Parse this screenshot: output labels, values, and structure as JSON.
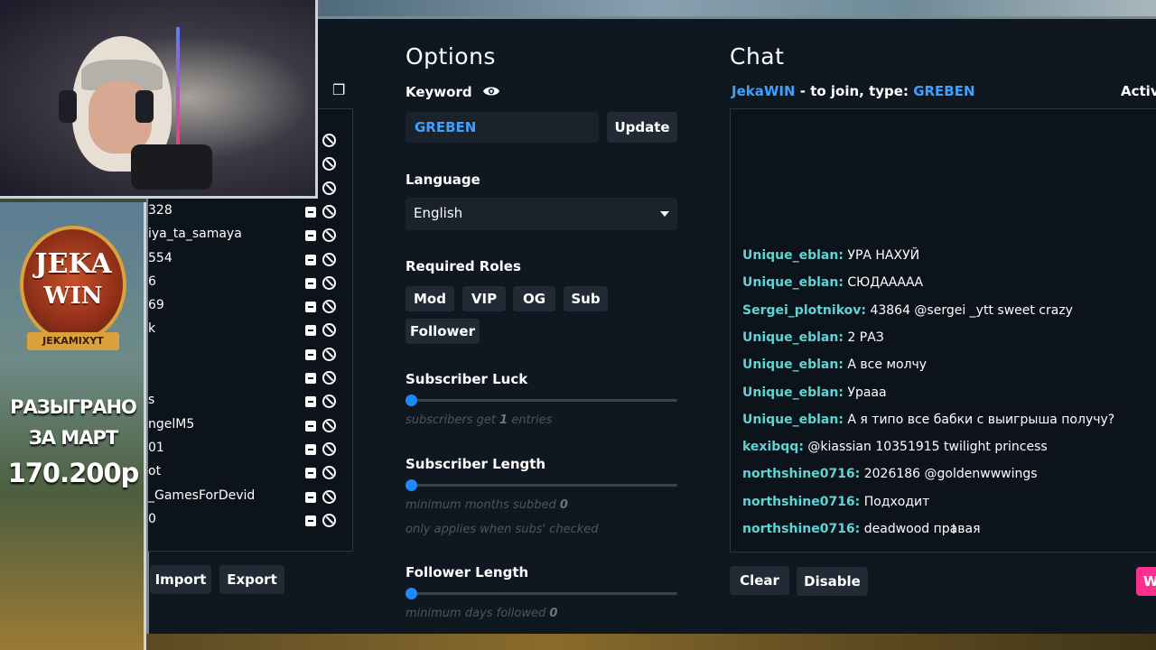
{
  "options": {
    "title": "Options",
    "keyword_label": "Keyword",
    "keyword_value": "GREBEN",
    "update_label": "Update",
    "language_label": "Language",
    "language_value": "English",
    "roles_label": "Required Roles",
    "roles": [
      "Mod",
      "VIP",
      "OG",
      "Sub",
      "Follower"
    ],
    "subscriber_luck_label": "Subscriber Luck",
    "subscriber_luck_hint_pre": "subscribers get",
    "subscriber_luck_value": "1",
    "subscriber_luck_hint_post": "entries",
    "subscriber_length_label": "Subscriber Length",
    "subscriber_length_hint_pre": "minimum months subbed",
    "subscriber_length_value": "0",
    "subscriber_length_note": "only applies when subs' checked",
    "follower_length_label": "Follower Length",
    "follower_length_hint_pre": "minimum days followed",
    "follower_length_value": "0"
  },
  "entries": {
    "users": [
      "328",
      "iya_ta_samaya",
      "554",
      "6",
      "69",
      "k",
      "",
      "",
      "s",
      "ngelM5",
      "01",
      "ot",
      "_GamesForDevid",
      "0"
    ],
    "import_label": "Import",
    "export_label": "Export"
  },
  "chat": {
    "title": "Chat",
    "streamer": "JekaWIN",
    "join_text": " - to join, type: ",
    "join_keyword": "GREBEN",
    "active_label": "Active",
    "messages": [
      {
        "user": "Unique_eblan:",
        "text": "УРА НАХУЙ"
      },
      {
        "user": "Unique_eblan:",
        "text": "СЮДААААА"
      },
      {
        "user": "Sergei_plotnikov:",
        "text": "43864 @sergei _ytt sweet crazy"
      },
      {
        "user": "Unique_eblan:",
        "text": "2 РАЗ"
      },
      {
        "user": "Unique_eblan:",
        "text": "А все молчу"
      },
      {
        "user": "Unique_eblan:",
        "text": "Урааа"
      },
      {
        "user": "Unique_eblan:",
        "text": "А я типо все бабки с выигрыша получу?"
      },
      {
        "user": "kexibqq:",
        "text": "@kiassian 10351915 twilight princess"
      },
      {
        "user": "northshine0716:",
        "text": "2026186 @goldenwwwings"
      },
      {
        "user": "northshine0716:",
        "text": "Подходит"
      },
      {
        "user": "northshine0716:",
        "text": "deadwood правая"
      }
    ],
    "clear_label": "Clear",
    "disable_label": "Disable",
    "winner_label": "W"
  },
  "overlay": {
    "brand_top": "JEKA",
    "brand_bottom": "WIN",
    "brand_tag": "JEKAMIXYT",
    "promo_line1": "РАЗЫГРАНО",
    "promo_line2": "ЗА МАРТ",
    "promo_amount": "170.200р"
  },
  "colors": {
    "panel_bg": "#0f1720",
    "accent_blue": "#3ea0ff",
    "chat_user": "#5fd4d4",
    "button_bg": "#222b35",
    "winner_pink": "#ff2f8f",
    "slider_knob": "#1e88ff"
  },
  "icons": {
    "keyword_visibility": "eye-icon",
    "copy": "copy-icon",
    "user_check": "checkbox-icon",
    "user_ban": "ban-icon",
    "language_caret": "chevron-down-icon"
  }
}
